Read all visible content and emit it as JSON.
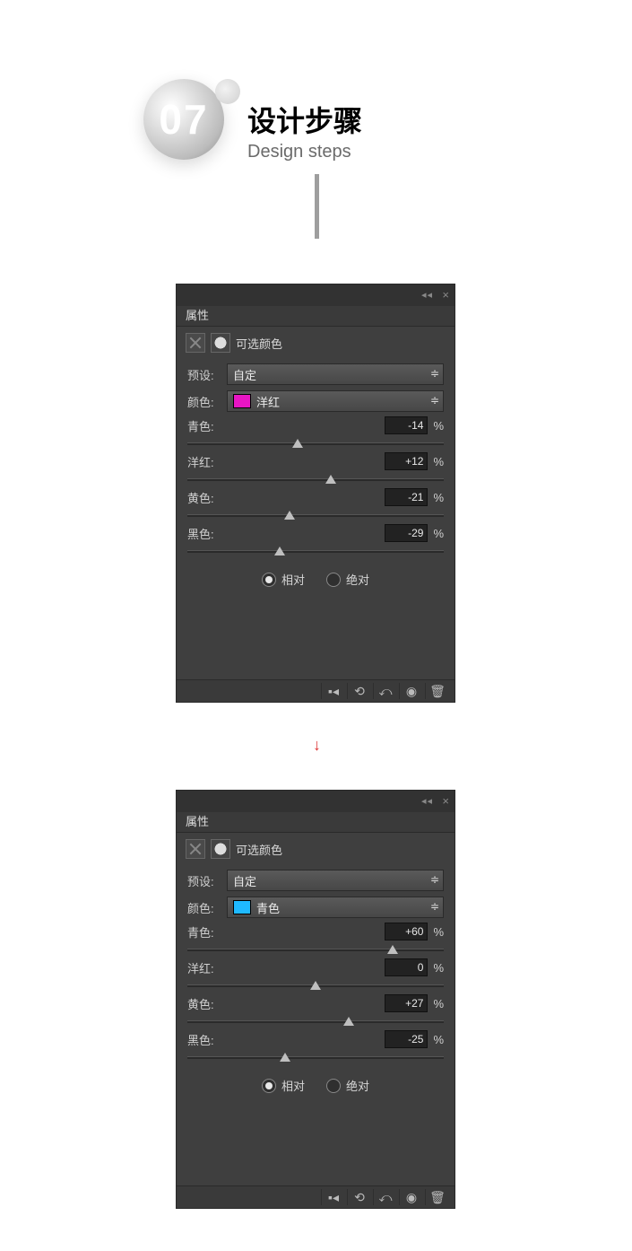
{
  "header": {
    "number": "07",
    "title_zh": "设计步骤",
    "title_en": "Design steps"
  },
  "arrow": "↓",
  "panels": [
    {
      "tab": "属性",
      "adj_name": "可选颜色",
      "preset_label": "预设:",
      "preset_value": "自定",
      "color_label": "颜色:",
      "color_value": "洋红",
      "swatch": "sw-magenta",
      "sliders": [
        {
          "label": "青色:",
          "value": "-14",
          "pos": 43
        },
        {
          "label": "洋红:",
          "value": "+12",
          "pos": 56
        },
        {
          "label": "黄色:",
          "value": "-21",
          "pos": 40
        },
        {
          "label": "黑色:",
          "value": "-29",
          "pos": 36
        }
      ],
      "rel": "相对",
      "abs": "绝对",
      "pct": "%"
    },
    {
      "tab": "属性",
      "adj_name": "可选颜色",
      "preset_label": "预设:",
      "preset_value": "自定",
      "color_label": "颜色:",
      "color_value": "青色",
      "swatch": "sw-cyan",
      "sliders": [
        {
          "label": "青色:",
          "value": "+60",
          "pos": 80
        },
        {
          "label": "洋红:",
          "value": "0",
          "pos": 50
        },
        {
          "label": "黄色:",
          "value": "+27",
          "pos": 63
        },
        {
          "label": "黑色:",
          "value": "-25",
          "pos": 38
        }
      ],
      "rel": "相对",
      "abs": "绝对",
      "pct": "%"
    }
  ]
}
